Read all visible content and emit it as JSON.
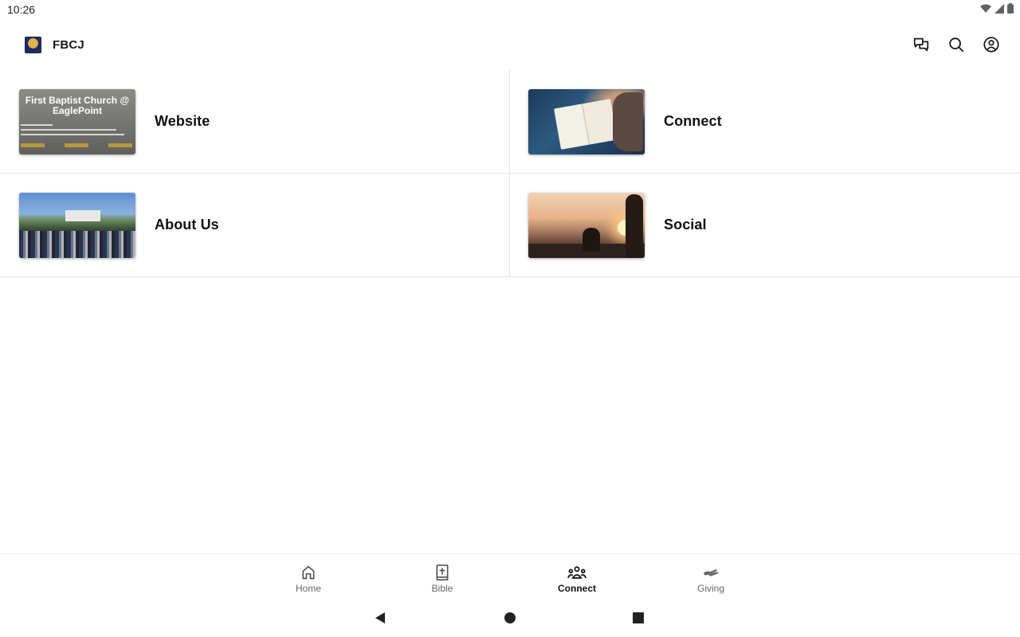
{
  "status_bar": {
    "time": "10:26",
    "icons": [
      "wifi-icon",
      "signal-icon",
      "battery-icon"
    ]
  },
  "app_bar": {
    "title": "FBCJ",
    "actions": [
      "chat-icon",
      "search-icon",
      "account-icon"
    ]
  },
  "tiles": [
    {
      "label": "Website",
      "thumb_title": "First Baptist Church @ EaglePoint"
    },
    {
      "label": "Connect"
    },
    {
      "label": "About Us"
    },
    {
      "label": "Social"
    }
  ],
  "bottom_nav": {
    "items": [
      {
        "label": "Home",
        "icon": "home-icon"
      },
      {
        "label": "Bible",
        "icon": "bible-icon"
      },
      {
        "label": "Connect",
        "icon": "people-icon",
        "active": true
      },
      {
        "label": "Giving",
        "icon": "giving-hand-icon"
      }
    ]
  },
  "system_nav": [
    "back-icon",
    "home-circle-icon",
    "recents-square-icon"
  ],
  "colors": {
    "background": "#ffffff",
    "divider": "#e6e6e6",
    "active_nav": "#111111",
    "inactive_nav": "#666666",
    "website_thumb_button": "#b8983e"
  }
}
